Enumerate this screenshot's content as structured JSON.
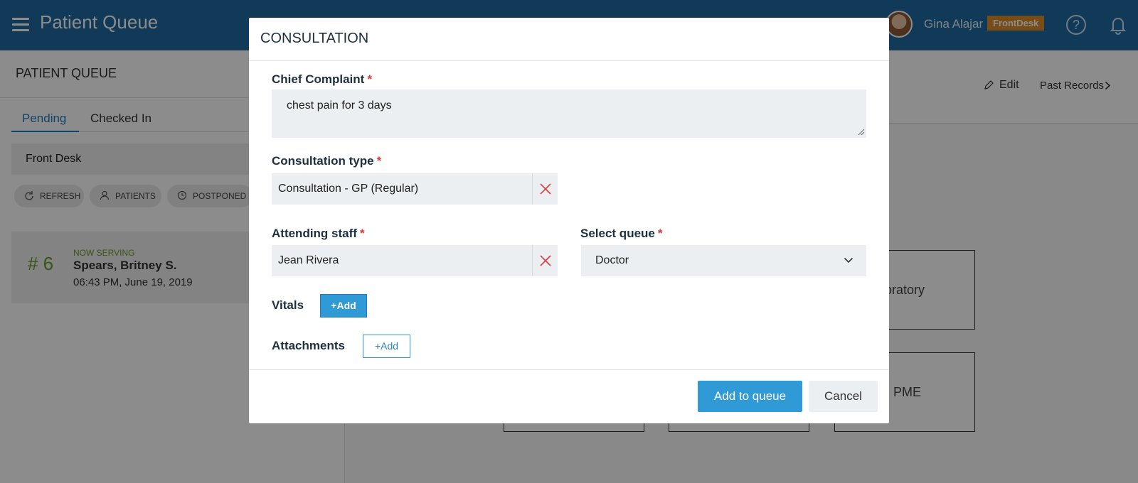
{
  "header": {
    "app_title": "Patient Queue",
    "user_name": "Gina Alajar",
    "role_badge": "FrontDesk",
    "help_glyph": "?"
  },
  "left_panel": {
    "title": "PATIENT QUEUE",
    "tabs": [
      {
        "label": "Pending",
        "active": true
      },
      {
        "label": "Checked In",
        "active": false
      }
    ],
    "desk_select_value": "Front Desk",
    "chips": [
      {
        "label": "REFRESH",
        "icon": "refresh-icon"
      },
      {
        "label": "PATIENTS",
        "icon": "user-icon"
      },
      {
        "label": "POSTPONED",
        "icon": "clock-icon"
      }
    ],
    "now_serving": {
      "number": "# 6",
      "label": "NOW SERVING",
      "name": "Spears, Britney S.",
      "time": "06:43 PM, June 19, 2019"
    }
  },
  "right_panel": {
    "edit_label": "Edit",
    "past_records_label": "Past Records",
    "partial_letter": "p",
    "service_boxes": [
      {
        "label": "poratory"
      },
      {
        "label": "PME"
      }
    ]
  },
  "modal": {
    "title": "CONSULTATION",
    "required_mark": "*",
    "chief_complaint": {
      "label": "Chief Complaint",
      "value": "chest pain for 3 days"
    },
    "consultation_type": {
      "label": "Consultation type",
      "value": "Consultation - GP (Regular)"
    },
    "attending_staff": {
      "label": "Attending staff",
      "value": "Jean Rivera"
    },
    "select_queue": {
      "label": "Select queue",
      "value": "Doctor"
    },
    "vitals": {
      "label": "Vitals",
      "add_label": "Add"
    },
    "attachments": {
      "label": "Attachments",
      "add_label": "Add"
    },
    "primary_button": "Add to queue",
    "cancel_button": "Cancel"
  },
  "colors": {
    "topbar": "#1e6aa0",
    "accent": "#2f9ad6",
    "badge": "#d98a2b",
    "serving_green": "#6b9a2b",
    "required_red": "#e03a3a"
  }
}
